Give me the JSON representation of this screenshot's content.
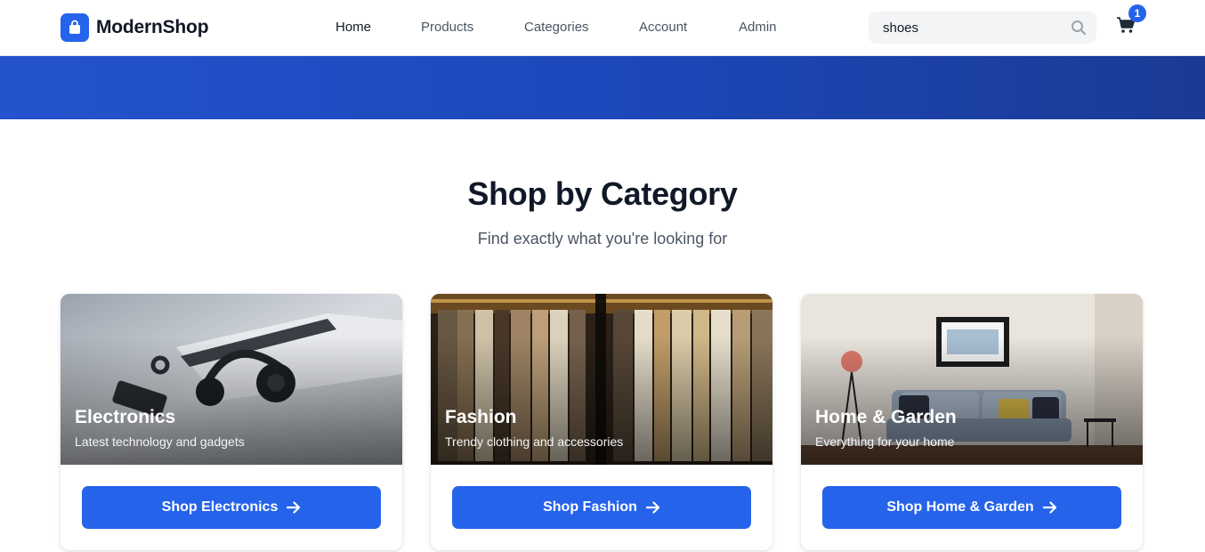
{
  "brand": {
    "name": "ModernShop",
    "icon": "shopping-bag-icon",
    "color": "#2563eb"
  },
  "nav": {
    "items": [
      {
        "label": "Home",
        "active": true
      },
      {
        "label": "Products",
        "active": false
      },
      {
        "label": "Categories",
        "active": false
      },
      {
        "label": "Account",
        "active": false
      },
      {
        "label": "Admin",
        "active": false
      }
    ]
  },
  "search": {
    "value": "shoes",
    "icon": "search-icon"
  },
  "cart": {
    "icon": "shopping-cart-icon",
    "count": "1"
  },
  "section": {
    "title": "Shop by Category",
    "subtitle": "Find exactly what you're looking for"
  },
  "categories": [
    {
      "title": "Electronics",
      "description": "Latest technology and gadgets",
      "button": "Shop Electronics"
    },
    {
      "title": "Fashion",
      "description": "Trendy clothing and accessories",
      "button": "Shop Fashion"
    },
    {
      "title": "Home & Garden",
      "description": "Everything for your home",
      "button": "Shop Home & Garden"
    }
  ],
  "colors": {
    "accent": "#2563eb",
    "hero_start": "#2453cd",
    "hero_end": "#1a3a95"
  }
}
